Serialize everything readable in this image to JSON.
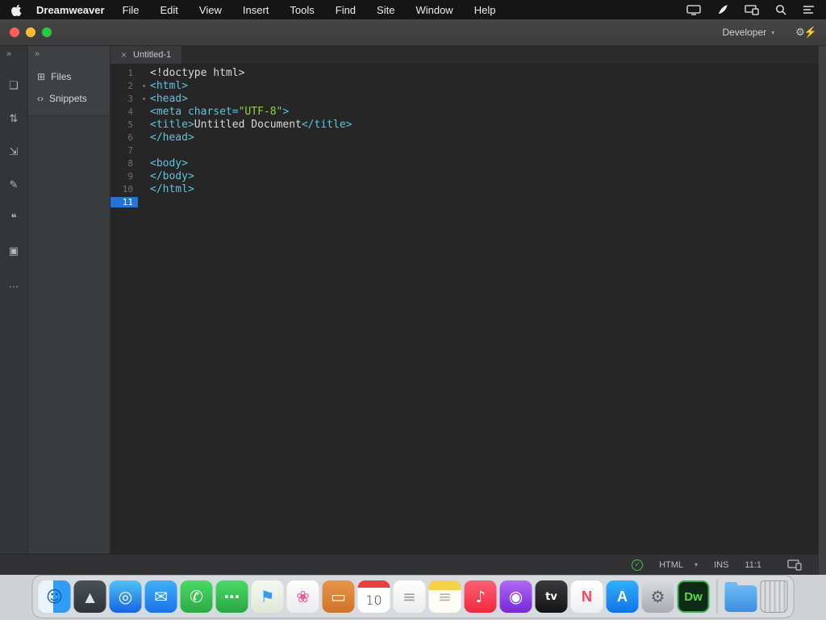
{
  "menubar": {
    "app_name": "Dreamweaver",
    "menus": [
      "File",
      "Edit",
      "View",
      "Insert",
      "Tools",
      "Find",
      "Site",
      "Window",
      "Help"
    ],
    "status_icons": [
      "display-icon",
      "feather-icon",
      "sidecar-icon",
      "spotlight-search-icon",
      "notification-list-icon"
    ]
  },
  "window": {
    "titlebar": {
      "workspace_label": "Developer",
      "workspace_chevron": "▾",
      "settings_glyphs": "⚙⚡"
    }
  },
  "rail": {
    "collapse_glyph": "»",
    "icons": [
      {
        "name": "document-icon",
        "glyph": "❏"
      },
      {
        "name": "sort-icon",
        "glyph": "⇅"
      },
      {
        "name": "expand-panels-icon",
        "glyph": "⇲"
      },
      {
        "name": "style-brush-icon",
        "glyph": "✎"
      },
      {
        "name": "comments-icon",
        "glyph": "❝"
      },
      {
        "name": "snippets-rail-icon",
        "glyph": "▣"
      },
      {
        "name": "more-options-icon",
        "glyph": "…"
      }
    ]
  },
  "sidebar": {
    "collapse_glyph": "»",
    "items": [
      {
        "name": "files-panel",
        "glyph": "⊞",
        "label": "Files"
      },
      {
        "name": "snippets-panel",
        "glyph": "‹›",
        "label": "Snippets"
      }
    ]
  },
  "tab": {
    "close_glyph": "×",
    "title": "Untitled-1"
  },
  "editor": {
    "fold_glyph": "▾",
    "colors": {
      "tag": "#5fc3dc",
      "attr": "#5fc3dc",
      "string": "#8ed04e",
      "plain": "#d9d9d9"
    },
    "lines": [
      {
        "num": 1,
        "segments": [
          {
            "text": "<!doctype html>",
            "type": "plain"
          }
        ]
      },
      {
        "num": 2,
        "fold": true,
        "segments": [
          {
            "text": "<html>",
            "type": "tag"
          }
        ]
      },
      {
        "num": 3,
        "fold": true,
        "segments": [
          {
            "text": "<head>",
            "type": "tag"
          }
        ]
      },
      {
        "num": 4,
        "segments": [
          {
            "text": "<meta",
            "type": "tag"
          },
          {
            "text": " charset=",
            "type": "attr"
          },
          {
            "text": "\"UTF-8\"",
            "type": "string"
          },
          {
            "text": ">",
            "type": "tag"
          }
        ]
      },
      {
        "num": 5,
        "segments": [
          {
            "text": "<title>",
            "type": "tag"
          },
          {
            "text": "Untitled Document",
            "type": "plain"
          },
          {
            "text": "</title>",
            "type": "tag"
          }
        ]
      },
      {
        "num": 6,
        "segments": [
          {
            "text": "</head>",
            "type": "tag"
          }
        ]
      },
      {
        "num": 7,
        "segments": []
      },
      {
        "num": 8,
        "segments": [
          {
            "text": "<body>",
            "type": "tag"
          }
        ]
      },
      {
        "num": 9,
        "segments": [
          {
            "text": "</body>",
            "type": "tag"
          }
        ]
      },
      {
        "num": 10,
        "segments": [
          {
            "text": "</html>",
            "type": "tag"
          }
        ]
      },
      {
        "num": 11,
        "cursor": true,
        "segments": []
      }
    ]
  },
  "statusbar": {
    "ok_glyph": "✓",
    "language": "HTML",
    "dropdown_glyph": "▾",
    "insert_mode": "INS",
    "cursor_position": "11:1"
  },
  "dock": {
    "items": [
      {
        "name": "finder",
        "type": "finder",
        "glyph": "☺"
      },
      {
        "name": "launchpad",
        "glyph": "▲",
        "c1": "#4b5158",
        "c2": "#2f343a",
        "fg": "#dfe3e8"
      },
      {
        "name": "safari",
        "glyph": "◎",
        "c1": "#4fc3f7",
        "c2": "#1565e0",
        "fg": "#ffffff"
      },
      {
        "name": "mail",
        "glyph": "✉",
        "c1": "#3fb0f7",
        "c2": "#1a73e8",
        "fg": "#ffffff"
      },
      {
        "name": "facetime",
        "glyph": "✆",
        "c1": "#4cd964",
        "c2": "#2bab46",
        "fg": "#ffffff"
      },
      {
        "name": "messages",
        "glyph": "⋯",
        "c1": "#4cd964",
        "c2": "#28a745",
        "fg": "#ffffff"
      },
      {
        "name": "maps",
        "glyph": "⚑",
        "c1": "#f4f8f0",
        "c2": "#dfe9d8",
        "fg": "#2f9ced"
      },
      {
        "name": "photos",
        "glyph": "❀",
        "c1": "#ffffff",
        "c2": "#ececec",
        "fg": "#e85d9e"
      },
      {
        "name": "books",
        "glyph": "▭",
        "c1": "#e8954a",
        "c2": "#cf7426",
        "fg": "#ffffff"
      },
      {
        "name": "calendar",
        "type": "calendar",
        "day": "10"
      },
      {
        "name": "reminders",
        "glyph": "≡",
        "c1": "#ffffff",
        "c2": "#ececec",
        "fg": "#9aa0a6"
      },
      {
        "name": "notes",
        "type": "notes",
        "glyph": "≡"
      },
      {
        "name": "music",
        "glyph": "♪",
        "c1": "#fc6076",
        "c2": "#f2273e",
        "fg": "#ffffff"
      },
      {
        "name": "podcasts",
        "glyph": "◉",
        "c1": "#b06af5",
        "c2": "#7526d9",
        "fg": "#ffffff"
      },
      {
        "name": "tv",
        "glyph": "tv",
        "c1": "#3a3a3c",
        "c2": "#141416",
        "fg": "#ffffff"
      },
      {
        "name": "news",
        "glyph": "N",
        "c1": "#ffffff",
        "c2": "#f0f0f2",
        "fg": "#fb415a"
      },
      {
        "name": "app-store",
        "glyph": "A",
        "c1": "#30b0fb",
        "c2": "#1273e8",
        "fg": "#ffffff"
      },
      {
        "name": "system-preferences",
        "glyph": "⚙",
        "c1": "#d8dadd",
        "c2": "#a9adb3",
        "fg": "#5a5e64"
      },
      {
        "name": "dreamweaver",
        "type": "dw",
        "glyph": "Dw"
      },
      {
        "type": "separator"
      },
      {
        "name": "downloads-folder",
        "type": "folder"
      },
      {
        "name": "trash",
        "type": "trash"
      }
    ]
  }
}
